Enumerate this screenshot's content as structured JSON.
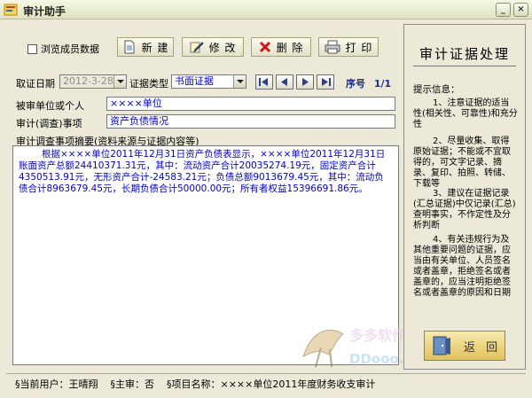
{
  "window": {
    "title": "审计助手"
  },
  "toolbar": {
    "browse_members_label": "浏览成员数据",
    "new_label": "新 建",
    "edit_label": "修 改",
    "delete_label": "删 除",
    "print_label": "打 印"
  },
  "form": {
    "date_label": "取证日期",
    "date_value": "2012-3-28",
    "type_label": "证据类型",
    "type_value": "书面证据",
    "sequence_label": "序号",
    "sequence_value": "1/1",
    "unit_label": "被审单位或个人",
    "unit_value": "××××单位",
    "matter_label": "审计(调查)事项",
    "matter_value": "资产负债情况",
    "summary_label": "审计调查事项摘要(资料来源与证据内容等)",
    "summary_text": "根据××××单位2011年12月31日资产负债表显示，××××单位2011年12月31日账面资产总额24410371.31元，其中：流动资产合计20035274.19元，固定资产合计4350513.91元，无形资产合计-24583.21元；负债总额9013679.45元，其中：流动负债合计8963679.45元，长期负债合计50000.00元；所有者权益15396691.86元。"
  },
  "panel": {
    "title": "审计证据处理",
    "tips_heading": "提示信息：",
    "tips": [
      "1、注意证据的适当性(相关性、可靠性)和充分性",
      "2、尽量收集、取得原始证据；不能或不宜取得的，可文字记录、摘录、复印、拍照、转储、下载等",
      "3、建议在证据记录(汇总证据)中仅记录(汇总)查明事实，不作定性及分析判断",
      "4、有关违规行为及其他重要问题的证据，应当由有关单位、人员签名或者盖章，拒绝签名或者盖章的，应当注明拒绝签名或者盖章的原因和日期"
    ],
    "return_label": "返 回"
  },
  "status": {
    "user": "§当前用户：王晴翔",
    "lead": "§主审：否",
    "project": "§项目名称：××××单位2011年度财务收支审计"
  },
  "watermark": {
    "text1": "多多软件站",
    "text2": "DDooo.com"
  },
  "colors": {
    "field_text": "#0000cc",
    "sequence": "#1a2f8a",
    "return_button": "#e2c35a"
  }
}
